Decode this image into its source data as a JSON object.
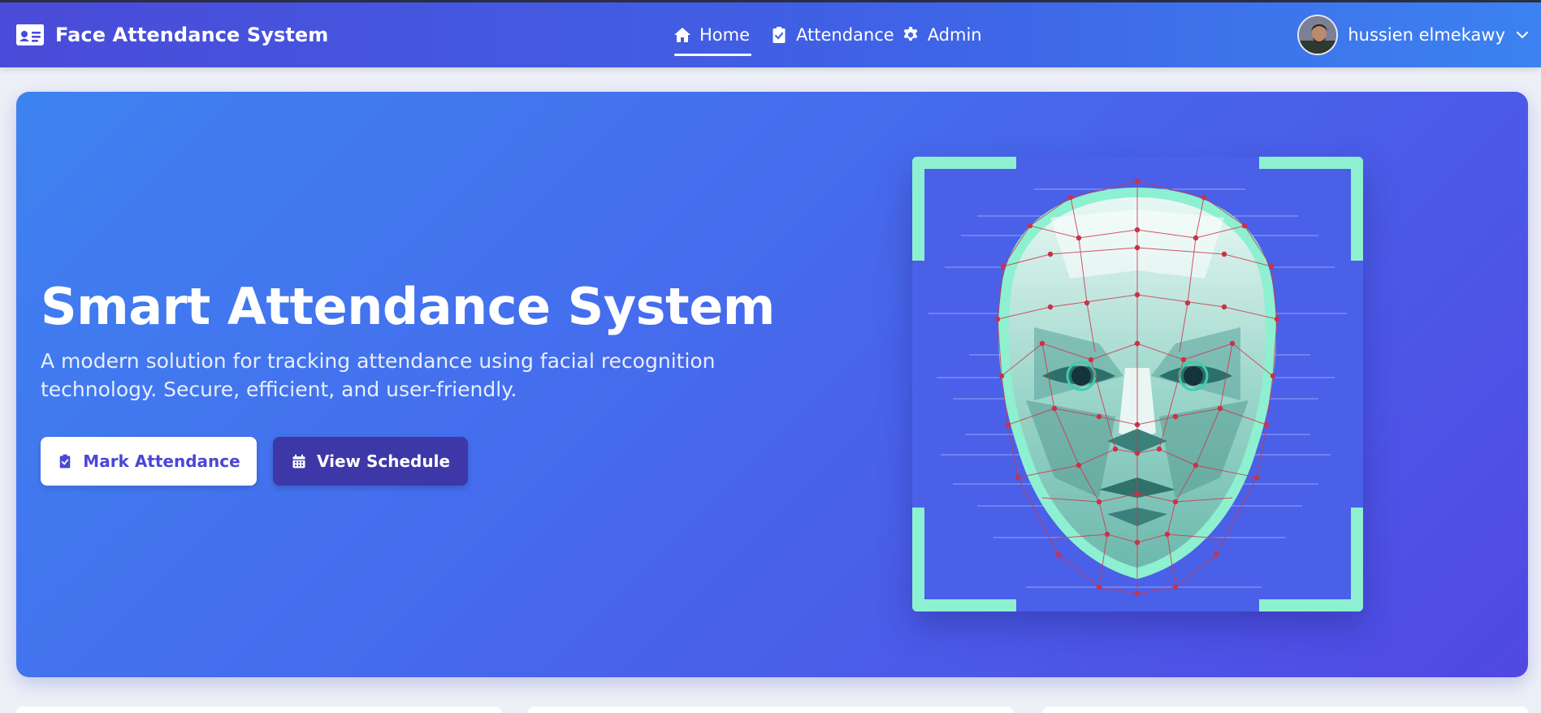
{
  "navbar": {
    "brand_title": "Face Attendance System",
    "brand_icon": "id-card-icon",
    "links": [
      {
        "label": "Home",
        "icon": "home-icon",
        "active": true
      },
      {
        "label": "Attendance",
        "icon": "clipboard-check-icon",
        "active": false
      },
      {
        "label": "Admin",
        "icon": "gear-icon",
        "active": false
      }
    ],
    "user": {
      "name": "hussien elmekawy",
      "menu_icon": "chevron-down-icon"
    }
  },
  "hero": {
    "title": "Smart Attendance System",
    "subtitle": "A modern solution for tracking attendance using facial recognition technology. Secure, efficient, and user-friendly.",
    "buttons": {
      "mark_label": "Mark Attendance",
      "mark_icon": "clipboard-check-icon",
      "schedule_label": "View Schedule",
      "schedule_icon": "calendar-icon"
    },
    "illustration": "face-scan-illustration"
  },
  "colors": {
    "nav_start": "#4a4bd8",
    "nav_end": "#3c82f0",
    "hero_start": "#3e82f0",
    "hero_end": "#5148e4",
    "scan_frame": "#8df0d0",
    "mesh_point": "#c8324a",
    "primary_button_text": "#4a47d6",
    "secondary_button_bg": "#3e37a8"
  }
}
